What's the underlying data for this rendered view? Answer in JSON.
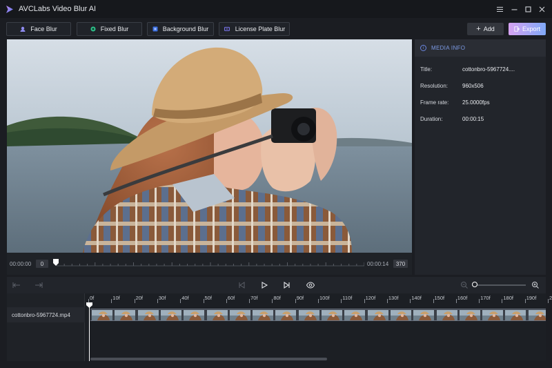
{
  "window": {
    "title": "AVCLabs Video Blur AI",
    "controls": [
      "menu-icon",
      "minimize-icon",
      "maximize-icon",
      "close-icon"
    ]
  },
  "toolbar": {
    "modes": [
      {
        "label": "Face Blur",
        "icon": "face-icon"
      },
      {
        "label": "Fixed Blur",
        "icon": "fixed-blur-icon"
      },
      {
        "label": "Background Blur",
        "icon": "background-icon"
      },
      {
        "label": "License Plate Blur",
        "icon": "license-plate-icon"
      }
    ],
    "add_label": "Add",
    "export_label": "Export"
  },
  "colors": {
    "accent": "#7d9be6",
    "export_gradient_start": "#d7a3f2",
    "export_gradient_end": "#7fa8f7",
    "background": "#1b1d22"
  },
  "scrubber": {
    "start_time": "00:00:00",
    "start_frame": "0",
    "end_time": "00:00:14",
    "end_frame": "370"
  },
  "media_info": {
    "header": "MEDIA INFO",
    "rows": [
      {
        "label": "Title:",
        "value": "cottonbro-5967724...."
      },
      {
        "label": "Resolution:",
        "value": "960x506"
      },
      {
        "label": "Frame rate:",
        "value": "25.0000fps"
      },
      {
        "label": "Duration:",
        "value": "00:00:15"
      }
    ]
  },
  "timeline": {
    "track_name": "cottonbro-5967724.mp4",
    "ruler": [
      "0f",
      "10f",
      "20f",
      "30f",
      "40f",
      "50f",
      "60f",
      "70f",
      "80f",
      "90f",
      "100f",
      "110f",
      "120f",
      "130f",
      "140f",
      "150f",
      "160f",
      "170f",
      "180f",
      "190f",
      "2"
    ],
    "zoom_level": 0
  }
}
